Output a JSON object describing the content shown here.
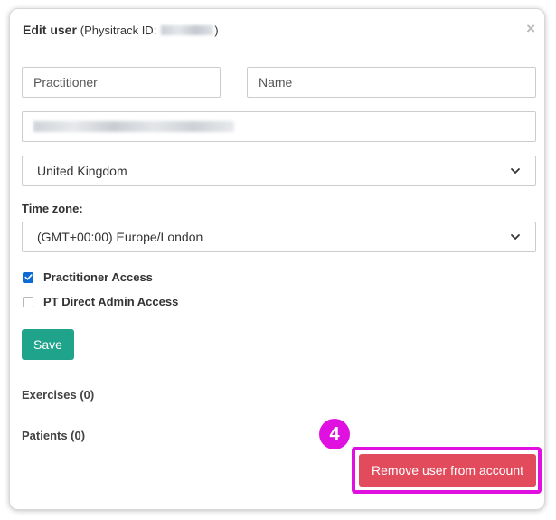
{
  "dialog": {
    "title": "Edit user",
    "subtitle_prefix": "(Physitrack ID:",
    "subtitle_suffix": ")",
    "close_glyph": "×"
  },
  "form": {
    "role_value": "Practitioner",
    "name_placeholder": "Name",
    "country_value": "United Kingdom",
    "timezone_label": "Time zone:",
    "timezone_value": "(GMT+00:00) Europe/London",
    "checkboxes": [
      {
        "label": "Practitioner Access",
        "checked": true
      },
      {
        "label": "PT Direct Admin Access",
        "checked": false
      }
    ],
    "save_label": "Save"
  },
  "sections": {
    "exercises": "Exercises (0)",
    "patients": "Patients (0)"
  },
  "actions": {
    "remove_label": "Remove user from account",
    "step_number": "4"
  },
  "colors": {
    "save": "#1fa38a",
    "remove": "#e14b5c",
    "highlight": "#e010e0",
    "checkbox_on": "#0b6bd3"
  },
  "icons": {
    "close": "close-icon",
    "select_arrow": "chevron-down-icon",
    "check": "check-icon"
  }
}
